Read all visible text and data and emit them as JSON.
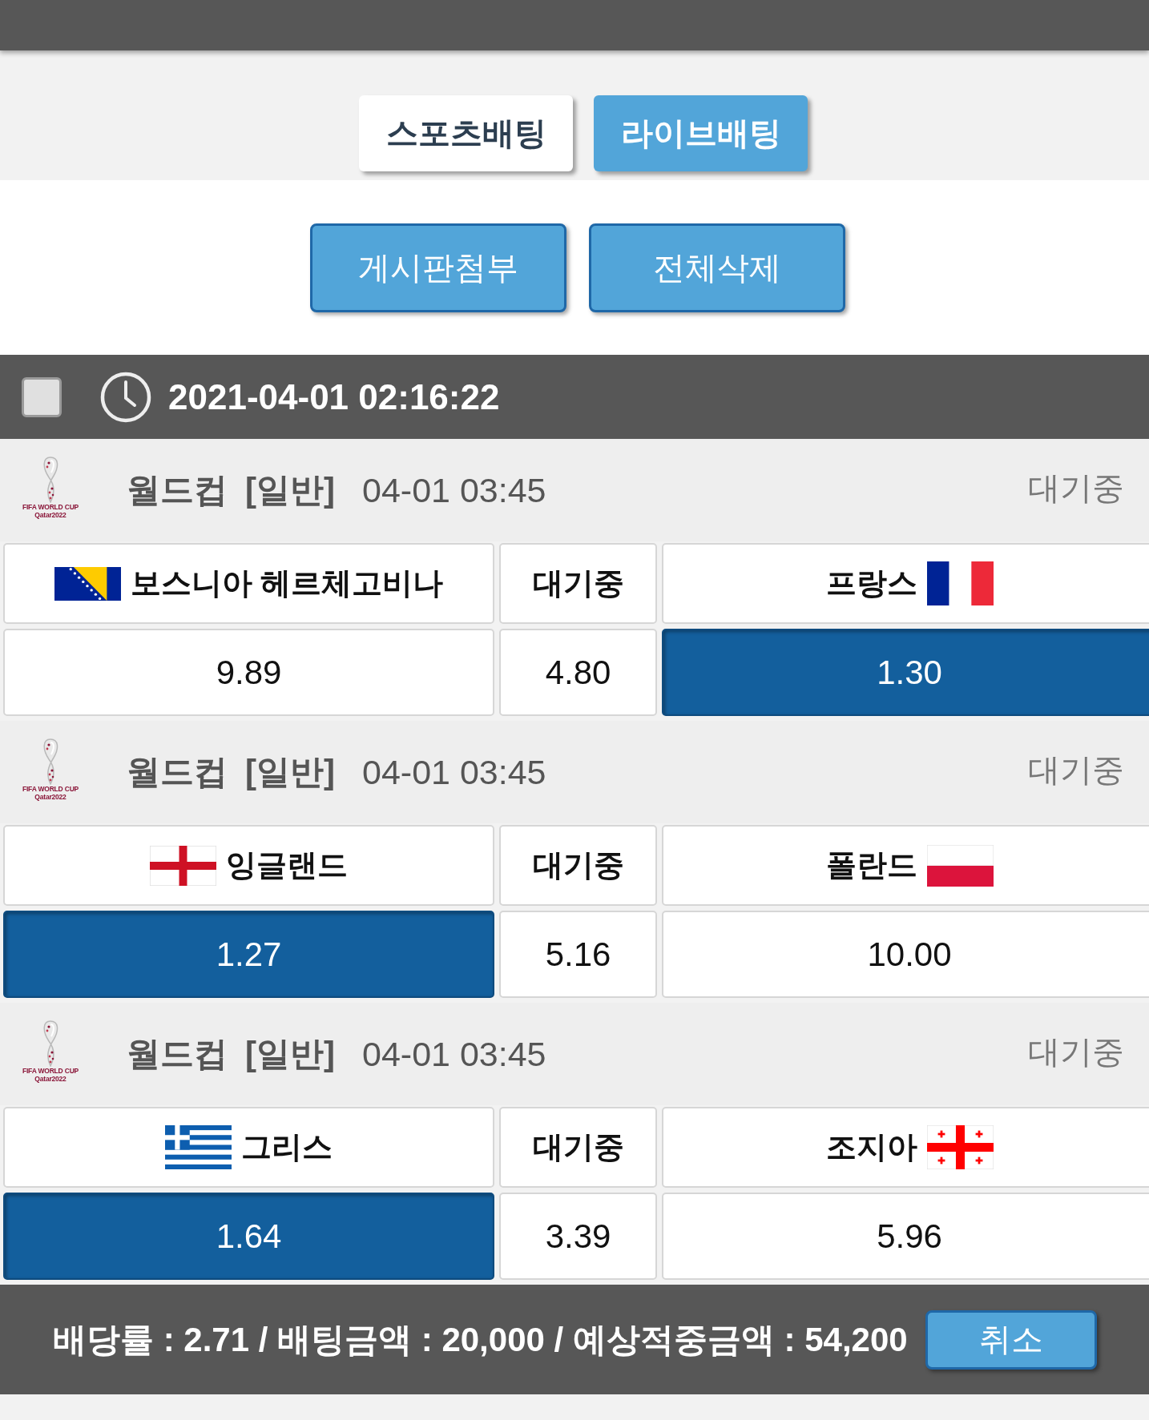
{
  "tabs": [
    {
      "label": "스포츠배팅",
      "selected": false
    },
    {
      "label": "라이브배팅",
      "selected": true
    }
  ],
  "actions": [
    {
      "label": "게시판첨부"
    },
    {
      "label": "전체삭제"
    }
  ],
  "slip": {
    "checked": false,
    "time": "2021-04-01 02:16:22"
  },
  "matches": [
    {
      "logo": [
        "FIFA WORLD CUP",
        "Qatar2022"
      ],
      "league": "월드컵",
      "type": "[일반]",
      "start": "04-01 03:45",
      "status": "대기중",
      "home": {
        "name": "보스니아 헤르체고비나",
        "flag": {
          "kind": "ba"
        }
      },
      "draw_label": "대기중",
      "away": {
        "name": "프랑스",
        "flag": {
          "kind": "fr"
        }
      },
      "odds": [
        {
          "value": "9.89",
          "selected": false
        },
        {
          "value": "4.80",
          "selected": false
        },
        {
          "value": "1.30",
          "selected": true
        }
      ]
    },
    {
      "logo": [
        "FIFA WORLD CUP",
        "Qatar2022"
      ],
      "league": "월드컵",
      "type": "[일반]",
      "start": "04-01 03:45",
      "status": "대기중",
      "home": {
        "name": "잉글랜드",
        "flag": {
          "kind": "eng"
        }
      },
      "draw_label": "대기중",
      "away": {
        "name": "폴란드",
        "flag": {
          "kind": "pl"
        }
      },
      "odds": [
        {
          "value": "1.27",
          "selected": true
        },
        {
          "value": "5.16",
          "selected": false
        },
        {
          "value": "10.00",
          "selected": false
        }
      ]
    },
    {
      "logo": [
        "FIFA WORLD CUP",
        "Qatar2022"
      ],
      "league": "월드컵",
      "type": "[일반]",
      "start": "04-01 03:45",
      "status": "대기중",
      "home": {
        "name": "그리스",
        "flag": {
          "kind": "gr"
        }
      },
      "draw_label": "대기중",
      "away": {
        "name": "조지아",
        "flag": {
          "kind": "ge"
        }
      },
      "odds": [
        {
          "value": "1.64",
          "selected": true
        },
        {
          "value": "3.39",
          "selected": false
        },
        {
          "value": "5.96",
          "selected": false
        }
      ]
    }
  ],
  "footer": {
    "summary": "배당률 : 2.71 / 배팅금액 : 20,000 / 예상적중금액 : 54,200",
    "cancel": "취소"
  }
}
